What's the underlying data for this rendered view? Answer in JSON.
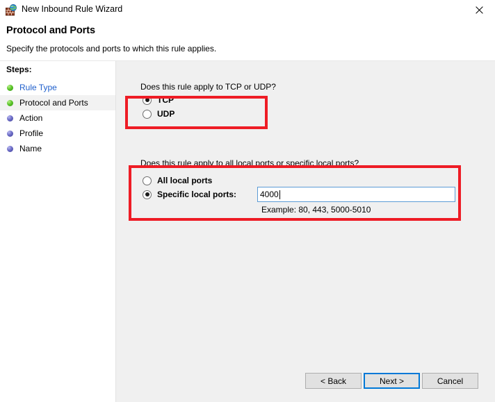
{
  "window": {
    "title": "New Inbound Rule Wizard",
    "icon": "firewall-globe-icon",
    "close_label": "✕"
  },
  "header": {
    "title": "Protocol and Ports",
    "subtitle": "Specify the protocols and ports to which this rule applies."
  },
  "sidebar": {
    "label": "Steps:",
    "items": [
      {
        "label": "Rule Type",
        "state": "link",
        "bullet": "green"
      },
      {
        "label": "Protocol and Ports",
        "state": "current",
        "bullet": "green"
      },
      {
        "label": "Action",
        "state": "pending",
        "bullet": "blue"
      },
      {
        "label": "Profile",
        "state": "pending",
        "bullet": "blue"
      },
      {
        "label": "Name",
        "state": "pending",
        "bullet": "blue"
      }
    ]
  },
  "main": {
    "protocol": {
      "question": "Does this rule apply to TCP or UDP?",
      "options": [
        {
          "label": "TCP",
          "checked": true
        },
        {
          "label": "UDP",
          "checked": false
        }
      ]
    },
    "ports": {
      "question": "Does this rule apply to all local ports or specific local ports?",
      "options": [
        {
          "label": "All local ports",
          "checked": false
        },
        {
          "label": "Specific local ports:",
          "checked": true
        }
      ],
      "input_value": "4000",
      "example": "Example: 80, 443, 5000-5010"
    }
  },
  "footer": {
    "back_label": "< Back",
    "next_label": "Next >",
    "cancel_label": "Cancel"
  },
  "annotations": {
    "color": "#ee1c25",
    "boxes": [
      "protocol-options",
      "local-ports-options"
    ]
  }
}
